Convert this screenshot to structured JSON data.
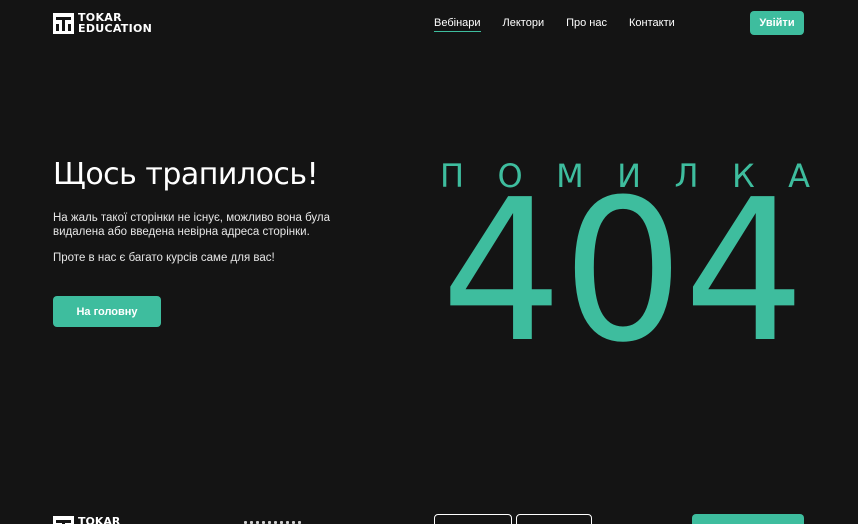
{
  "brand": {
    "line1": "TOKAR",
    "line2": "EDUCATION",
    "accent": "#3ebd9e",
    "background": "#141414",
    "icon": "tokar-logo-icon"
  },
  "nav": {
    "items": [
      {
        "label": "Вебінари",
        "active": true
      },
      {
        "label": "Лектори",
        "active": false
      },
      {
        "label": "Про нас",
        "active": false
      },
      {
        "label": "Контакти",
        "active": false
      }
    ],
    "login_label": "Увійти"
  },
  "error": {
    "title": "Щось трапилось!",
    "description": "На жаль такої сторінки не існує, можливо вона була видалена або введена невірна адреса сторінки.",
    "description2": "Проте в нас є багато курсів саме для вас!",
    "home_button": "На головну",
    "word_letters": [
      "П",
      "О",
      "М",
      "И",
      "Л",
      "К",
      "А"
    ],
    "code": "404"
  },
  "footer": {
    "brand_line1": "TOKAR"
  }
}
